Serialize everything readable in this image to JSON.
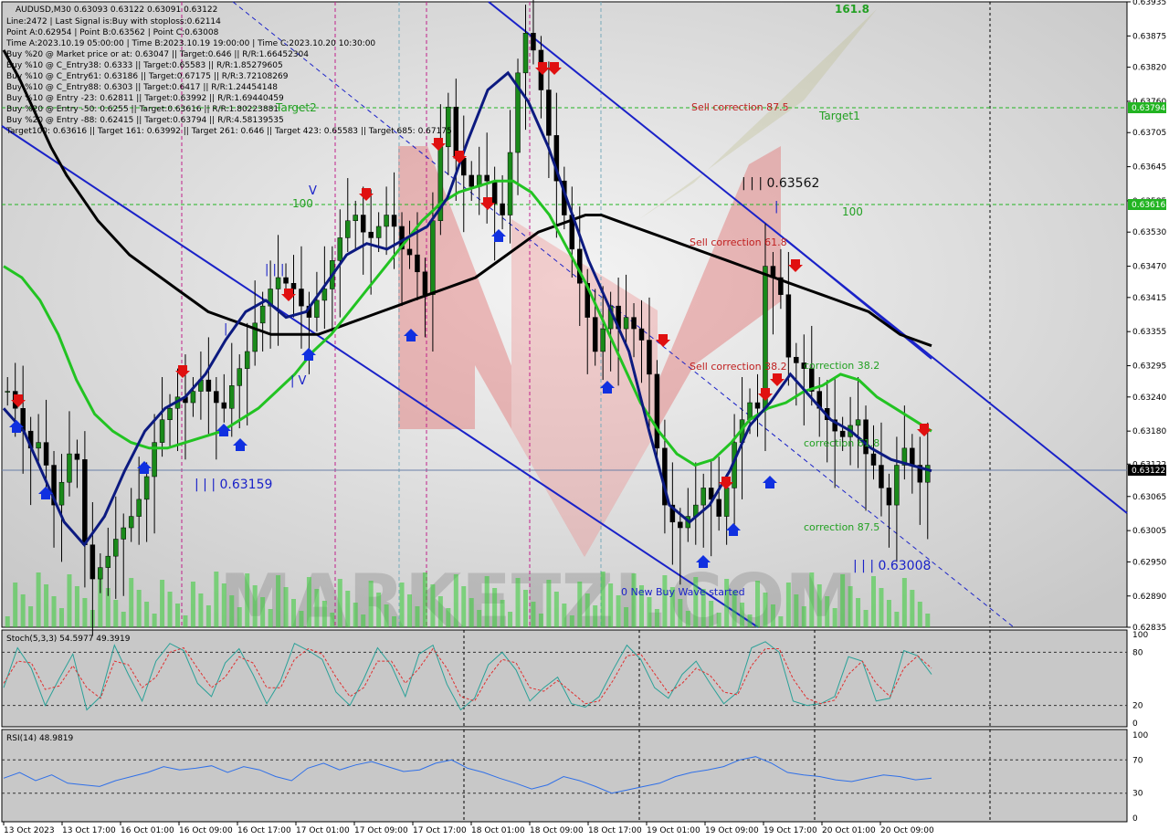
{
  "header": {
    "symbol": "AUDUSD,M30  0.63093 0.63122 0.63091 0.63122",
    "lines": [
      "Line:2472 | Last Signal is:Buy with stoploss:0.62114",
      "Point A:0.62954 | Point B:0.63562 | Point C:0.63008",
      "Time A:2023.10.19 05:00:00 | Time B:2023.10.19 19:00:00 | Time C:2023.10.20 10:30:00",
      "Buy %20 @ Market price or at: 0.63047 || Target:0.646 || R/R:1.66452304",
      "Buy %10 @ C_Entry38: 0.6333 || Target:0.65583 || R/R:1.85279605",
      "Buy %10 @ C_Entry61: 0.63186 || Target:0.67175 || R/R:3.72108269",
      "Buy %10 @ C_Entry88: 0.6303 || Target:0.6417 || R/R:1.24454148",
      "Buy %10 @ Entry -23: 0.62811 || Target:0.63992 || R/R:1.69440459",
      "Buy %20 @ Entry -50: 0.6255 || Target:0.63616 || R/R:1.80223881",
      "Buy %20 @ Entry -88: 0.62415 || Target:0.63794 || R/R:4.58139535",
      "Target100: 0.63616 || Target 161: 0.63992 || Target 261: 0.646 || Target 423: 0.65583 || Target 685: 0.67175"
    ]
  },
  "annotations": {
    "target2": "Target2",
    "target1": "Target1",
    "lvl161": "161.8",
    "lvl100a": "100",
    "lvl100b": "100",
    "sell875": "Sell correction 87.5",
    "sell618": "Sell correction 61.8",
    "sell382": "Sell correction 38.2",
    "corr382": "correction 38.2",
    "corr618": "correction 61.8",
    "corr875": "correction 87.5",
    "pointB": "| | | 0.63562",
    "pointLow1": "| | | 0.63159",
    "pointC": "| | | 0.63008",
    "newWave": "0 New Buy Wave started",
    "wave3": "| | |",
    "wave1": "|",
    "wave4": "| V",
    "wave5": "V",
    "waveB1": "|"
  },
  "chart_data": [
    {
      "type": "line",
      "title": "AUDUSD,M30",
      "ylim": [
        0.62835,
        0.63935
      ],
      "y_ticks": [
        "0.63935",
        "0.63875",
        "0.63820",
        "0.63760",
        "0.63705",
        "0.63645",
        "0.63585",
        "0.63530",
        "0.63470",
        "0.63415",
        "0.63355",
        "0.63295",
        "0.63240",
        "0.63180",
        "0.63122",
        "0.63065",
        "0.63005",
        "0.62950",
        "0.62890",
        "0.62835"
      ],
      "x_ticks": [
        "13 Oct 2023",
        "13 Oct 17:00",
        "16 Oct 01:00",
        "16 Oct 09:00",
        "16 Oct 17:00",
        "17 Oct 01:00",
        "17 Oct 09:00",
        "17 Oct 17:00",
        "18 Oct 01:00",
        "18 Oct 09:00",
        "18 Oct 17:00",
        "19 Oct 01:00",
        "19 Oct 09:00",
        "19 Oct 17:00",
        "20 Oct 01:00",
        "20 Oct 09:00"
      ],
      "current_price": "0.63122",
      "target_labels": [
        "0.63794",
        "0.63616"
      ],
      "close": [
        0.6325,
        0.6322,
        0.6318,
        0.6315,
        0.6316,
        0.6312,
        0.6305,
        0.6309,
        0.6314,
        0.6313,
        0.6298,
        0.6292,
        0.6294,
        0.6296,
        0.6299,
        0.6301,
        0.6303,
        0.6306,
        0.631,
        0.6316,
        0.632,
        0.6322,
        0.6324,
        0.6323,
        0.6325,
        0.6327,
        0.6325,
        0.6323,
        0.6322,
        0.6326,
        0.6329,
        0.6332,
        0.6337,
        0.634,
        0.6343,
        0.6345,
        0.6344,
        0.6343,
        0.634,
        0.6338,
        0.6341,
        0.6343,
        0.6348,
        0.6352,
        0.6355,
        0.6356,
        0.6353,
        0.6352,
        0.6354,
        0.6356,
        0.6354,
        0.635,
        0.6349,
        0.6346,
        0.6342,
        0.6355,
        0.6368,
        0.6375,
        0.6366,
        0.6363,
        0.6361,
        0.6363,
        0.6362,
        0.6358,
        0.6356,
        0.6367,
        0.6381,
        0.6388,
        0.6385,
        0.6378,
        0.637,
        0.6362,
        0.6356,
        0.635,
        0.6344,
        0.6338,
        0.6332,
        0.6336,
        0.634,
        0.6336,
        0.6338,
        0.6336,
        0.6334,
        0.6328,
        0.6315,
        0.6305,
        0.6302,
        0.6301,
        0.6303,
        0.6305,
        0.6308,
        0.6306,
        0.6303,
        0.6308,
        0.6316,
        0.632,
        0.6323,
        0.6322,
        0.6347,
        0.6345,
        0.6342,
        0.6331,
        0.633,
        0.6329,
        0.6325,
        0.6322,
        0.632,
        0.6318,
        0.6317,
        0.6319,
        0.632,
        0.6314,
        0.6312,
        0.6308,
        0.6305,
        0.6312,
        0.6315,
        0.6312,
        0.6309,
        0.6312
      ],
      "series": [
        {
          "name": "",
          "color": "#000000",
          "values": [
            0.6385,
            0.638,
            0.6374,
            0.6368,
            0.6363,
            0.6359,
            0.6355,
            0.6352,
            0.6349,
            0.6347,
            0.6345,
            0.6343,
            0.6341,
            0.6339,
            0.6338,
            0.6337,
            0.6336,
            0.6335,
            0.6335,
            0.6335,
            0.6335,
            0.6336,
            0.6337,
            0.6338,
            0.6339,
            0.634,
            0.6341,
            0.6342,
            0.6343,
            0.6344,
            0.6345,
            0.6347,
            0.6349,
            0.6351,
            0.6353,
            0.6354,
            0.6355,
            0.6356,
            0.6356,
            0.6355,
            0.6354,
            0.6353,
            0.6352,
            0.6351,
            0.635,
            0.6349,
            0.6348,
            0.6347,
            0.6346,
            0.6345,
            0.6344,
            0.6343,
            0.6342,
            0.6341,
            0.634,
            0.6339,
            0.6337,
            0.6335,
            0.6334,
            0.6333
          ]
        },
        {
          "name": "",
          "color": "#22c322",
          "values": [
            0.6347,
            0.6345,
            0.6341,
            0.6335,
            0.6327,
            0.6321,
            0.6318,
            0.6316,
            0.6315,
            0.6315,
            0.6316,
            0.6317,
            0.6318,
            0.632,
            0.6322,
            0.6325,
            0.6328,
            0.6332,
            0.6335,
            0.6339,
            0.6343,
            0.6347,
            0.6351,
            0.6355,
            0.6358,
            0.636,
            0.6361,
            0.6362,
            0.6362,
            0.636,
            0.6356,
            0.635,
            0.6344,
            0.6337,
            0.633,
            0.6323,
            0.6318,
            0.6314,
            0.6312,
            0.6313,
            0.6316,
            0.632,
            0.6322,
            0.6323,
            0.6325,
            0.6326,
            0.6328,
            0.6327,
            0.6324,
            0.6322,
            0.632,
            0.6318
          ]
        },
        {
          "name": "",
          "color": "#0c1a80",
          "values": [
            0.6322,
            0.6318,
            0.631,
            0.6302,
            0.6298,
            0.6303,
            0.6311,
            0.6318,
            0.6322,
            0.6324,
            0.6328,
            0.6334,
            0.6339,
            0.6341,
            0.6338,
            0.6339,
            0.6344,
            0.6349,
            0.6351,
            0.635,
            0.6352,
            0.6354,
            0.6359,
            0.6369,
            0.6378,
            0.6381,
            0.6376,
            0.6368,
            0.6358,
            0.6348,
            0.634,
            0.6332,
            0.6318,
            0.6305,
            0.6302,
            0.6305,
            0.6311,
            0.6319,
            0.6323,
            0.6328,
            0.6324,
            0.632,
            0.6318,
            0.6315,
            0.6313,
            0.6312,
            0.6311
          ]
        }
      ]
    },
    {
      "type": "line",
      "title": "Stoch(5,3,3) 54.5977 49.3919",
      "ylim": [
        0,
        100
      ],
      "y_ticks": [
        "100",
        "80",
        "20",
        "0"
      ],
      "series": [
        {
          "name": "",
          "color": "#2aa198",
          "values": [
            40,
            85,
            62,
            20,
            50,
            78,
            15,
            30,
            88,
            55,
            25,
            70,
            90,
            82,
            45,
            30,
            68,
            84,
            55,
            22,
            48,
            90,
            82,
            72,
            35,
            20,
            50,
            85,
            65,
            30,
            78,
            88,
            44,
            15,
            28,
            66,
            80,
            60,
            25,
            40,
            52,
            22,
            18,
            30,
            60,
            88,
            72,
            40,
            28,
            55,
            70,
            45,
            22,
            35,
            85,
            92,
            80,
            25,
            20,
            22,
            30,
            75,
            70,
            25,
            28,
            82,
            76,
            55
          ]
        },
        {
          "name": "",
          "color": "#e03030",
          "values": [
            45,
            70,
            68,
            38,
            42,
            65,
            40,
            28,
            70,
            66,
            40,
            52,
            80,
            85,
            62,
            40,
            52,
            75,
            68,
            40,
            40,
            72,
            84,
            78,
            52,
            30,
            40,
            70,
            70,
            45,
            62,
            84,
            62,
            30,
            25,
            52,
            72,
            68,
            40,
            36,
            48,
            35,
            22,
            25,
            48,
            76,
            78,
            56,
            34,
            45,
            62,
            54,
            35,
            32,
            65,
            84,
            84,
            50,
            28,
            22,
            26,
            55,
            70,
            45,
            30,
            62,
            76,
            62
          ]
        }
      ]
    },
    {
      "type": "line",
      "title": "RSI(14) 48.9819",
      "ylim": [
        0,
        100
      ],
      "y_ticks": [
        "100",
        "70",
        "30",
        "0"
      ],
      "series": [
        {
          "name": "",
          "color": "#3070e8",
          "values": [
            48,
            55,
            45,
            52,
            42,
            40,
            38,
            45,
            50,
            55,
            62,
            58,
            60,
            63,
            55,
            62,
            58,
            50,
            45,
            60,
            66,
            58,
            64,
            68,
            62,
            56,
            58,
            66,
            70,
            60,
            55,
            48,
            42,
            35,
            40,
            50,
            45,
            38,
            30,
            34,
            38,
            42,
            50,
            55,
            58,
            62,
            70,
            74,
            66,
            55,
            52,
            50,
            46,
            44,
            48,
            52,
            50,
            46,
            48
          ]
        }
      ]
    }
  ]
}
